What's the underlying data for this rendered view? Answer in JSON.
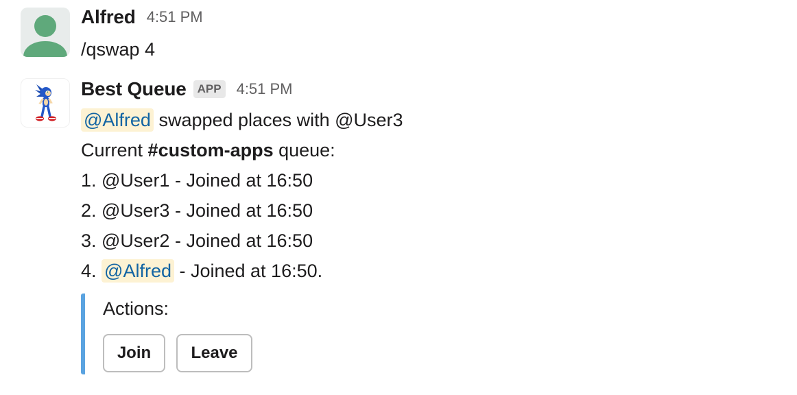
{
  "messages": [
    {
      "author": "Alfred",
      "time": "4:51 PM",
      "text": "/qswap 4",
      "avatar_icon": "default-user-avatar-icon"
    },
    {
      "author": "Best Queue",
      "badge": "APP",
      "time": "4:51 PM",
      "avatar_icon": "sonic-character-avatar-icon",
      "swap_mention": "@Alfred",
      "swap_text": " swapped places with @User3",
      "queue_prefix": "Current ",
      "queue_channel": "#custom-apps",
      "queue_suffix": " queue:",
      "queue": [
        "1. @User1 - Joined at 16:50",
        "2. @User3 - Joined at 16:50",
        "3. @User2 - Joined at 16:50"
      ],
      "queue_last_prefix": "4. ",
      "queue_last_mention": "@Alfred",
      "queue_last_suffix": " - Joined at 16:50.",
      "attachment": {
        "title": "Actions:",
        "buttons": [
          "Join",
          "Leave"
        ]
      }
    }
  ],
  "colors": {
    "mention_bg": "#fdf2d3",
    "mention_text": "#1264a3",
    "attachment_bar": "#5aa3e0",
    "user_avatar": "#5fa97b"
  }
}
